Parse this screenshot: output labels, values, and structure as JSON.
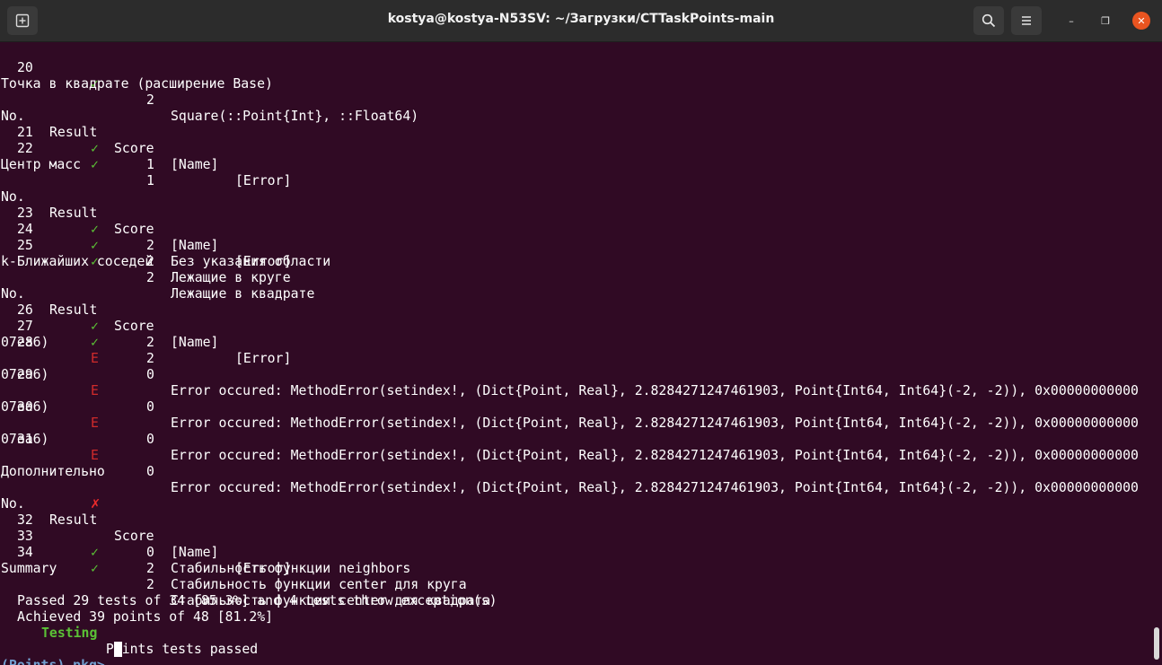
{
  "window": {
    "title": "kostya@kostya-N53SV: ~/Загрузки/CTTaskPoints-main",
    "icons": {
      "new_tab": "new-tab-icon",
      "search": "search-icon",
      "menu": "hamburger-menu-icon",
      "minimize": "minimize-icon",
      "maximize": "maximize-icon",
      "close": "close-icon"
    },
    "glyphs": {
      "minimize": "–",
      "maximize": "❐",
      "close": "✕"
    }
  },
  "colors": {
    "background": "#300a24",
    "titlebar": "#2c2c2c",
    "text": "#ffffff",
    "pass": "#5bc236",
    "error": "#d02b2b",
    "prompt": "#729fcf",
    "close_button": "#e95420"
  },
  "header_cols": {
    "no": "No.",
    "result": "Result",
    "score": "Score",
    "name": "[Name]",
    "error": "[Error]"
  },
  "marks": {
    "pass": "✓",
    "fail": "✗",
    "error": "E"
  },
  "rows": {
    "r20": {
      "no": "20",
      "score": "2",
      "name": "Square(::Point{Int}, ::Float64)"
    },
    "r21": {
      "no": "21",
      "score": "1"
    },
    "r22": {
      "no": "22",
      "score": "1"
    },
    "r23": {
      "no": "23",
      "score": "2",
      "name": "Без указания области"
    },
    "r24": {
      "no": "24",
      "score": "2",
      "name": "Лежащие в круге"
    },
    "r25": {
      "no": "25",
      "score": "2",
      "name": "Лежащие в квадрате"
    },
    "r26": {
      "no": "26",
      "score": "2"
    },
    "r27": {
      "no": "27",
      "score": "2"
    },
    "r28": {
      "no": "28",
      "score": "0"
    },
    "r29": {
      "no": "29",
      "score": "0"
    },
    "r30": {
      "no": "30",
      "score": "0"
    },
    "r31": {
      "no": "31",
      "score": "0"
    },
    "r32": {
      "no": "32",
      "score": "0",
      "name": "Стабильность функции neighbors"
    },
    "r33": {
      "no": "33",
      "score": "2",
      "name": "Стабильность функции center для круга"
    },
    "r34": {
      "no": "34",
      "score": "2",
      "name": "Стабильность функции center для квадрата"
    }
  },
  "error_message": "Error occured: MethodError(setindex!, (Dict{Point, Real}, 2.8284271247461903, Point{Int64, Int64}(-2, -2)), 0x00000000000",
  "error_wrap": "07ea6)",
  "sections": {
    "square": "Точка в квадрате (расширение Base)",
    "center": "Центр масс",
    "knn": "k-Ближайших соседей",
    "extra": "Дополнительно"
  },
  "summary": {
    "title": "Summary",
    "passed": "Passed 29 tests of 34 [85.3%] and 4 tests throw exception(s)",
    "achieved": "Achieved 39 points of 48 [81.2%]",
    "testing_word": "Testing",
    "testing_rest": " Points tests passed"
  },
  "prompt": "(Points) pkg>"
}
